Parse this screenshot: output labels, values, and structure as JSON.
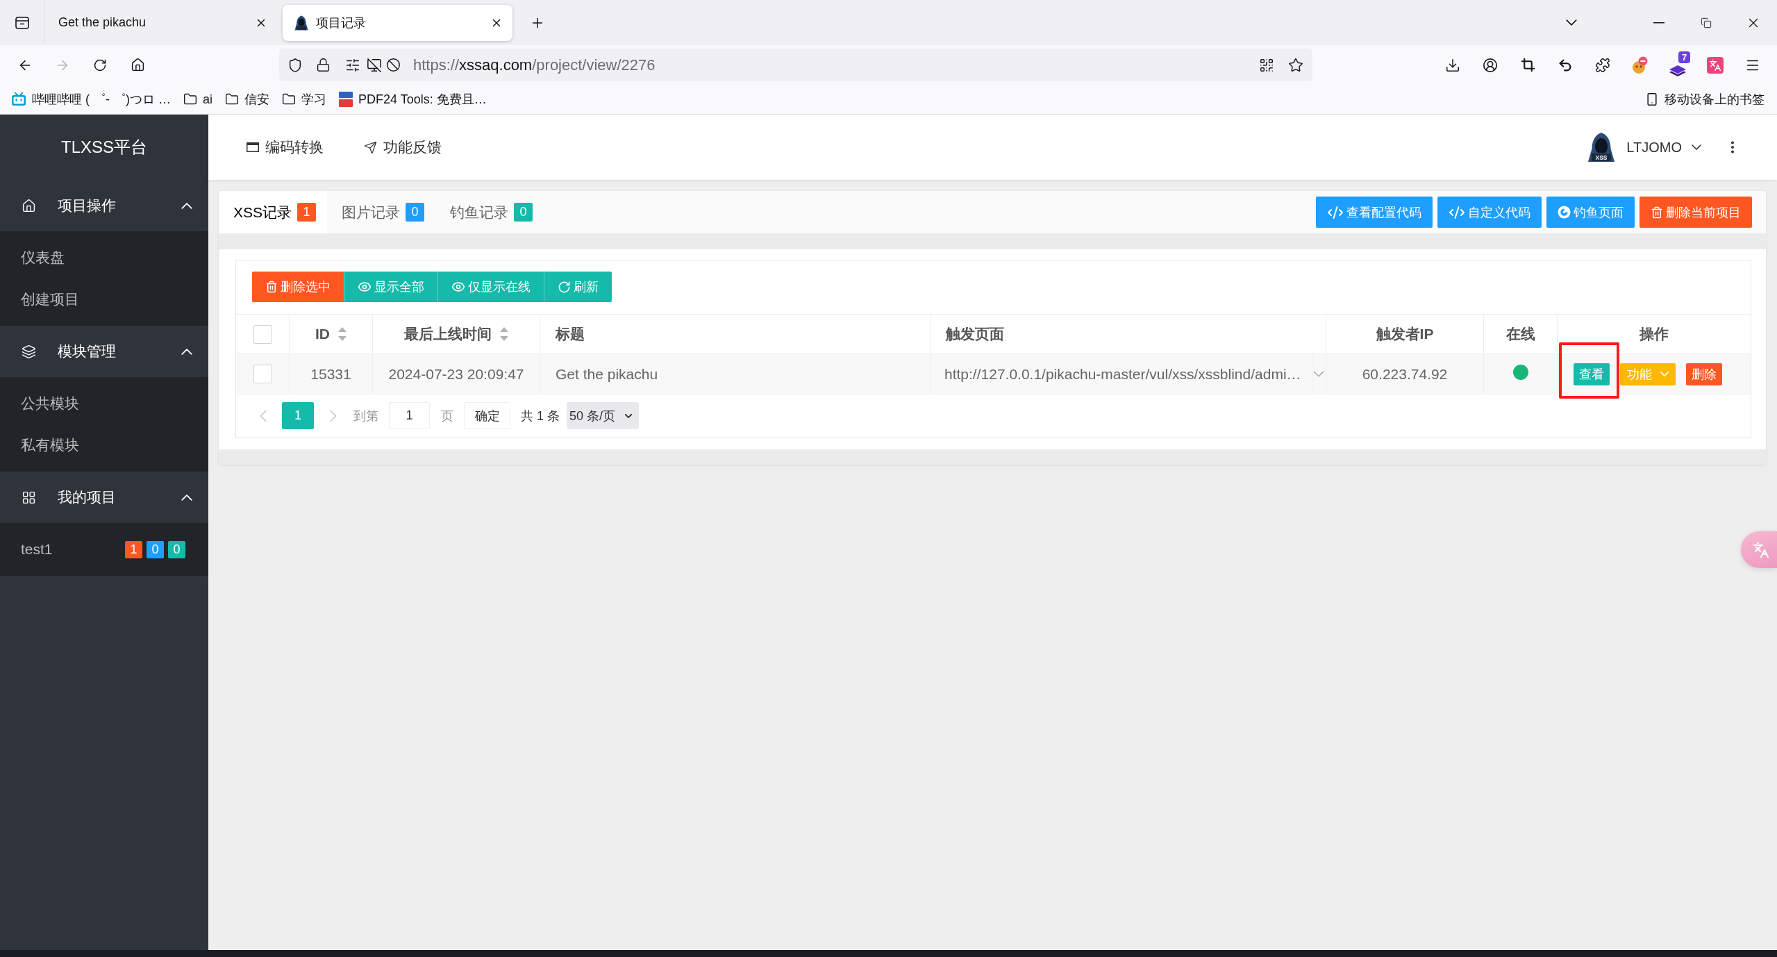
{
  "browser": {
    "tabs": [
      {
        "title": "Get the pikachu",
        "selected": false,
        "favicon": false
      },
      {
        "title": "项目记录",
        "selected": true,
        "favicon": true
      }
    ],
    "back_disabled": false,
    "forward_disabled": true,
    "url": {
      "scheme": "https://",
      "host": "xssaq.com",
      "path": "/project/view/2276"
    },
    "extension_badge": "7",
    "bookmarks": [
      {
        "kind": "site",
        "label": "哔哩哔哩 ( ゜- ゜)つロ …"
      },
      {
        "kind": "folder",
        "label": "ai"
      },
      {
        "kind": "folder",
        "label": "信安"
      },
      {
        "kind": "folder",
        "label": "学习"
      },
      {
        "kind": "pdf",
        "label": "PDF24 Tools: 免费且…"
      }
    ],
    "mobile_bookmarks": "移动设备上的书签"
  },
  "sidebar": {
    "logo": "TLXSS平台",
    "groups": [
      {
        "kind": "home",
        "label": "项目操作",
        "expanded": true,
        "items": [
          {
            "label": "仪表盘"
          },
          {
            "label": "创建项目"
          }
        ]
      },
      {
        "kind": "layers",
        "label": "模块管理",
        "expanded": true,
        "items": [
          {
            "label": "公共模块"
          },
          {
            "label": "私有模块"
          }
        ]
      },
      {
        "kind": "grid",
        "label": "我的项目",
        "expanded": true,
        "items": [
          {
            "label": "test1",
            "badges": [
              {
                "count": "1",
                "color": "#ff5722"
              },
              {
                "count": "0",
                "color": "#1e9fff"
              },
              {
                "count": "0",
                "color": "#16baaa"
              }
            ]
          }
        ]
      }
    ]
  },
  "header": {
    "links": [
      {
        "kind": "window",
        "label": "编码转换"
      },
      {
        "kind": "send",
        "label": "功能反馈"
      }
    ],
    "user": {
      "name": "LTJOMO",
      "avatar_text": "XSS"
    }
  },
  "records": {
    "tabs": [
      {
        "label": "XSS记录",
        "count": "1",
        "color": "#ff5722",
        "selected": true
      },
      {
        "label": "图片记录",
        "count": "0",
        "color": "#1e9fff",
        "selected": false
      },
      {
        "label": "钓鱼记录",
        "count": "0",
        "color": "#16baaa",
        "selected": false
      }
    ],
    "actions": [
      {
        "kind": "code",
        "label": "查看配置代码",
        "color": "#1e9fff"
      },
      {
        "kind": "code",
        "label": "自定义代码",
        "color": "#1e9fff"
      },
      {
        "kind": "swirl",
        "label": "钓鱼页面",
        "color": "#1e9fff"
      },
      {
        "kind": "trash",
        "label": "删除当前项目",
        "color": "#ff5722"
      }
    ],
    "toolbar": [
      {
        "kind": "trash",
        "label": "删除选中",
        "color": "#ff5722"
      },
      {
        "kind": "eye",
        "label": "显示全部",
        "color": "#16baaa"
      },
      {
        "kind": "eye",
        "label": "仅显示在线",
        "color": "#16baaa"
      },
      {
        "kind": "refresh",
        "label": "刷新",
        "color": "#16baaa"
      }
    ],
    "table": {
      "select_all": {
        "checked": false
      },
      "columns": [
        {
          "label": "ID",
          "sortable": true
        },
        {
          "label": "最后上线时间",
          "sortable": true
        },
        {
          "label": "标题",
          "sortable": false
        },
        {
          "label": "触发页面",
          "sortable": false
        },
        {
          "label": "触发者IP",
          "sortable": false
        },
        {
          "label": "在线",
          "sortable": false
        },
        {
          "label": "操作",
          "sortable": false
        }
      ],
      "rows": [
        {
          "checked": false,
          "id": "15331",
          "time": "2024-07-23 20:09:47",
          "title": "Get the pikachu",
          "page": "http://127.0.0.1/pikachu-master/vul/xss/xssblind/admi…",
          "ip": "60.223.74.92",
          "online": true,
          "actions": [
            {
              "kind": "view",
              "label": "查看",
              "highlighted": true
            },
            {
              "kind": "menu",
              "label": "功能",
              "highlighted": false
            },
            {
              "kind": "delete",
              "label": "删除",
              "highlighted": false
            }
          ]
        }
      ]
    },
    "pager": {
      "pages": [
        {
          "label": "1",
          "selected": true
        }
      ],
      "goto_label": "到第",
      "goto_value": "1",
      "page_unit": "页",
      "confirm": "确定",
      "total": "共 1 条",
      "page_size": "50 条/页"
    }
  }
}
